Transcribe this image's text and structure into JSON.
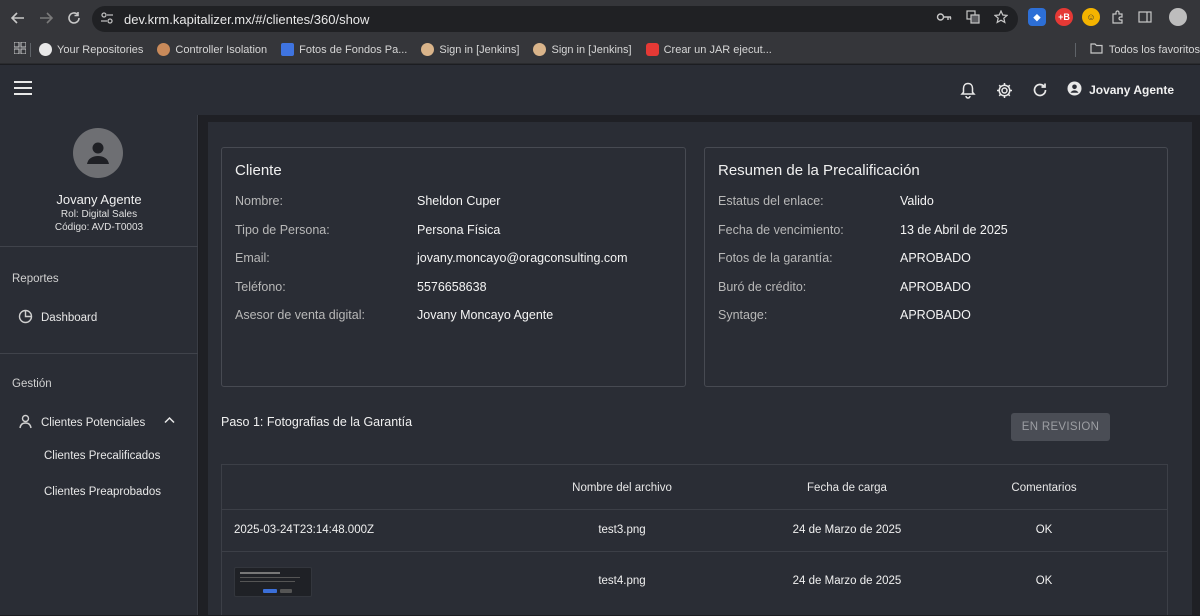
{
  "browser": {
    "url": "dev.krm.kapitalizer.mx/#/clientes/360/show",
    "bookmarks": [
      {
        "label": "Your Repositories",
        "color": "#e8e8e8"
      },
      {
        "label": "Controller Isolation",
        "color": "#c98a5a"
      },
      {
        "label": "Fotos de Fondos Pa...",
        "color": "#3f74e0"
      },
      {
        "label": "Sign in [Jenkins]",
        "color": "#d9b48a"
      },
      {
        "label": "Sign in [Jenkins]",
        "color": "#d9b48a"
      },
      {
        "label": "Crear un JAR ejecut...",
        "color": "#e53935"
      }
    ],
    "all_bookmarks_label": "Todos los favoritos"
  },
  "appbar": {
    "user_name": "Jovany Agente"
  },
  "sidebar": {
    "profile": {
      "name": "Jovany Agente",
      "role": "Rol: Digital Sales",
      "code": "Código: AVD-T0003"
    },
    "sections": [
      {
        "title": "Reportes",
        "items": [
          {
            "label": "Dashboard",
            "icon": "pie-chart-icon"
          }
        ]
      },
      {
        "title": "Gestión",
        "items": [
          {
            "label": "Clientes Potenciales",
            "icon": "person-icon",
            "expanded": true,
            "children": [
              "Clientes Precalificados",
              "Clientes Preaprobados"
            ]
          }
        ]
      }
    ]
  },
  "cliente": {
    "title": "Cliente",
    "fields": [
      {
        "label": "Nombre:",
        "value": "Sheldon Cuper"
      },
      {
        "label": "Tipo de Persona:",
        "value": "Persona Física"
      },
      {
        "label": "Email:",
        "value": "jovany.moncayo@oragconsulting.com"
      },
      {
        "label": "Teléfono:",
        "value": "5576658638"
      },
      {
        "label": "Asesor de venta digital:",
        "value": "Jovany Moncayo Agente"
      }
    ]
  },
  "resumen": {
    "title": "Resumen de la Precalificación",
    "fields": [
      {
        "label": "Estatus del enlace:",
        "value": "Valido"
      },
      {
        "label": "Fecha de vencimiento:",
        "value": "13 de Abril de 2025"
      },
      {
        "label": "Fotos de la garantía:",
        "value": "APROBADO"
      },
      {
        "label": "Buró de crédito:",
        "value": "APROBADO"
      },
      {
        "label": "Syntage:",
        "value": "APROBADO"
      }
    ]
  },
  "step": {
    "title": "Paso 1: Fotografias de la Garantía",
    "status_label": "EN REVISION"
  },
  "table": {
    "headers": [
      "Nombre del archivo",
      "Fecha de carga",
      "Comentarios"
    ],
    "rows": [
      {
        "preview": "2025-03-24T23:14:48.000Z",
        "file": "test3.png",
        "date": "24 de Marzo de 2025",
        "comment": "OK"
      },
      {
        "preview": "",
        "file": "test4.png",
        "date": "24 de Marzo de 2025",
        "comment": "OK"
      }
    ]
  }
}
